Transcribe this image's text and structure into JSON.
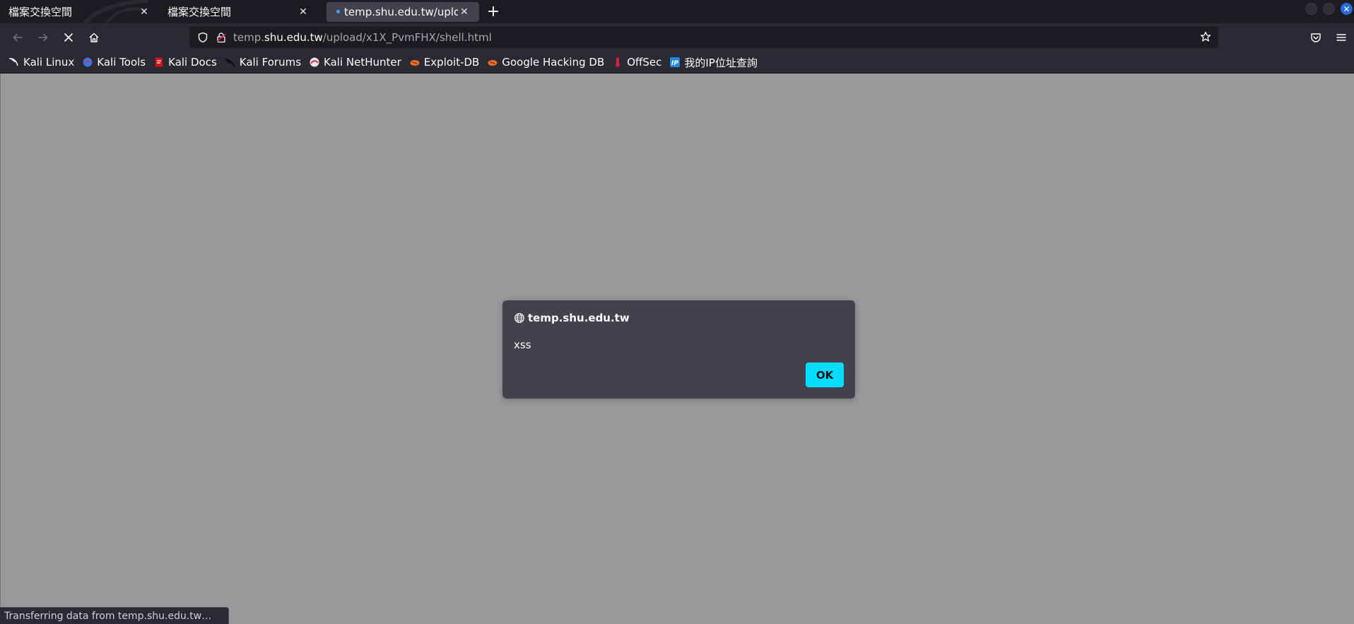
{
  "tabs": [
    {
      "title": "檔案交換空間",
      "close": "✕"
    },
    {
      "title": "檔案交換空間",
      "close": "✕"
    },
    {
      "title": "temp.shu.edu.tw/upload/",
      "close": "✕",
      "active": true,
      "loading": true
    }
  ],
  "new_tab_label": "+",
  "window_controls": [
    "minimize",
    "maximize",
    "close"
  ],
  "nav": {
    "back": "back-arrow-icon",
    "forward": "forward-arrow-icon",
    "stop": "stop-x-icon",
    "home": "home-icon"
  },
  "url": {
    "prefix": "temp.",
    "host": "shu.edu.tw",
    "path": "/upload/x1X_PvmFHX/shell.html"
  },
  "bookmarks": [
    {
      "label": "Kali Linux",
      "icon": "kali-dragon-icon"
    },
    {
      "label": "Kali Tools",
      "icon": "kali-tools-icon"
    },
    {
      "label": "Kali Docs",
      "icon": "kali-docs-icon"
    },
    {
      "label": "Kali Forums",
      "icon": "kali-forums-icon"
    },
    {
      "label": "Kali NetHunter",
      "icon": "nethunter-icon"
    },
    {
      "label": "Exploit-DB",
      "icon": "exploitdb-icon"
    },
    {
      "label": "Google Hacking DB",
      "icon": "ghdb-icon"
    },
    {
      "label": "OffSec",
      "icon": "offsec-icon"
    },
    {
      "label": "我的IP位址查詢",
      "icon": "ip-icon"
    }
  ],
  "dialog": {
    "origin": "temp.shu.edu.tw",
    "message": "xss",
    "ok_label": "OK"
  },
  "status": "Transferring data from temp.shu.edu.tw…",
  "colors": {
    "tabstrip": "#1c1b22",
    "toolbar": "#2b2a33",
    "dialog": "#42414d",
    "accent": "#00ddff",
    "content_overlay": "#9a9a9c"
  }
}
